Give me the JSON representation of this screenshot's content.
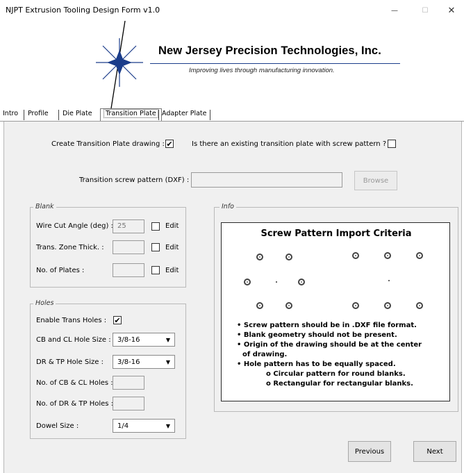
{
  "window": {
    "title": "NJPT Extrusion Tooling Design Form v1.0",
    "minimize_glyph": "—",
    "maximize_glyph": "☐",
    "close_glyph": "✕"
  },
  "header": {
    "company": "New Jersey Precision Technologies, Inc.",
    "tagline": "Improving lives through manufacturing innovation."
  },
  "tabs": [
    {
      "label": "Intro"
    },
    {
      "label": "Profile"
    },
    {
      "label": "Die Plate"
    },
    {
      "label": "Transition Plate",
      "selected": true
    },
    {
      "label": "Adapter Plate"
    }
  ],
  "top": {
    "create_drawing_label": "Create Transition Plate drawing :",
    "create_drawing_checked": "✔",
    "existing_pattern_label": "Is there an existing transition plate with screw pattern ?",
    "existing_pattern_checked": "",
    "screw_pattern_label": "Transition screw pattern (DXF) :",
    "screw_pattern_value": "",
    "browse_label": "Browse"
  },
  "blank": {
    "title": "Blank",
    "wire_cut_label": "Wire Cut Angle (deg) :",
    "wire_cut_value": "25",
    "trans_zone_label": "Trans. Zone Thick. :",
    "trans_zone_value": "",
    "plates_label": "No. of Plates :",
    "plates_value": "",
    "edit_label": "Edit"
  },
  "holes": {
    "title": "Holes",
    "enable_label": "Enable Trans Holes :",
    "enable_checked": "✔",
    "cb_cl_size_label": "CB and CL Hole Size :",
    "cb_cl_size_value": "3/8-16",
    "dr_tp_size_label": "DR & TP Hole Size :",
    "dr_tp_size_value": "3/8-16",
    "cb_cl_count_label": "No. of CB & CL Holes :",
    "cb_cl_count_value": "",
    "dr_tp_count_label": "No. of DR & TP Holes :",
    "dr_tp_count_value": "",
    "dowel_label": "Dowel Size :",
    "dowel_value": "1/4",
    "dropdown_arrow": "▼"
  },
  "info": {
    "title": "Info",
    "criteria_title": "Screw Pattern Import Criteria",
    "criteria": [
      "• Screw pattern should be in .DXF file format.",
      "• Blank geometry should not be present.",
      "• Origin of the drawing should be at the center",
      "   of drawing.",
      "• Hole pattern has to be equally spaced.",
      "o Circular pattern for round blanks.",
      "o Rectangular for rectangular blanks."
    ]
  },
  "nav": {
    "previous_label": "Previous",
    "next_label": "Next"
  },
  "colors": {
    "page_bg": "#f0f0f0",
    "logo_star": "#1a3c8a"
  },
  "icons": [
    "star-logo-icon",
    "checkmark-icon",
    "dropdown-arrow-icon"
  ]
}
